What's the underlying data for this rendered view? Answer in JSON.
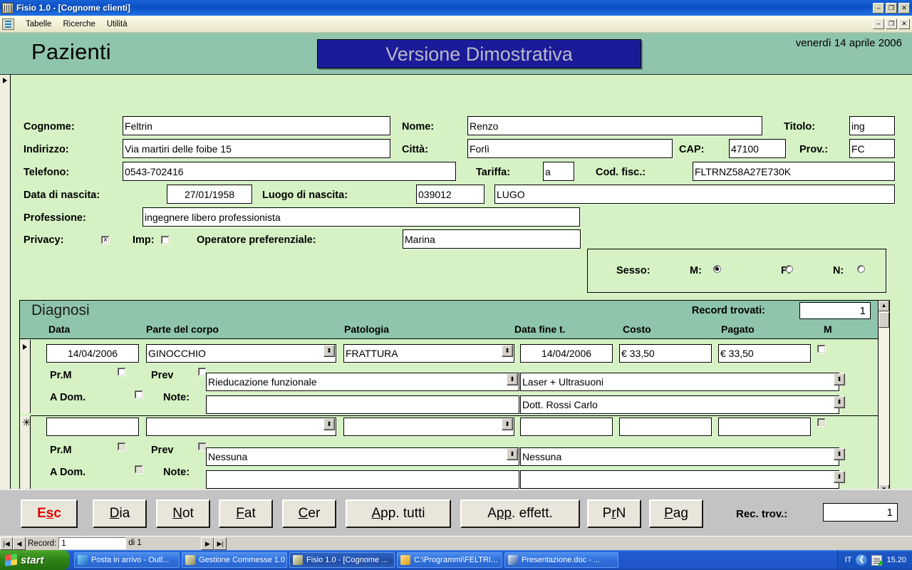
{
  "window": {
    "title": "Fisio 1.0 - [Cognome clienti]",
    "minimize": "–",
    "restore": "❐",
    "close": "✕"
  },
  "menu": {
    "items": [
      {
        "label": "Tabelle"
      },
      {
        "label": "Ricerche"
      },
      {
        "label": "Utilità"
      }
    ],
    "minimize": "–",
    "restore": "❐",
    "close": "✕"
  },
  "header": {
    "page_title": "Pazienti",
    "demo_badge": "Versione Dimostrativa",
    "today": "venerdì 14 aprile 2006"
  },
  "patient": {
    "cognome_label": "Cognome:",
    "cognome": "Feltrin",
    "nome_label": "Nome:",
    "nome": "Renzo",
    "titolo_label": "Titolo:",
    "titolo": "ing",
    "indirizzo_label": "Indirizzo:",
    "indirizzo": "Via martiri delle foibe 15",
    "citta_label": "Città:",
    "citta": "Forlì",
    "cap_label": "CAP:",
    "cap": "47100",
    "prov_label": "Prov.:",
    "prov": "FC",
    "telefono_label": "Telefono:",
    "telefono": "0543-702416",
    "tariffa_label": "Tariffa:",
    "tariffa": "a",
    "codfisc_label": "Cod. fisc.:",
    "codfisc": "FLTRNZ58A27E730K",
    "data_nascita_label": "Data di nascita:",
    "data_nascita": "27/01/1958",
    "luogo_nascita_label": "Luogo di nascita:",
    "luogo_nascita_code": "039012",
    "luogo_nascita": "LUGO",
    "professione_label": "Professione:",
    "professione": "ingegnere libero professionista",
    "privacy_label": "Privacy:",
    "privacy_checked": "x",
    "imp_label": "Imp:",
    "imp_checked": "",
    "operatore_label": "Operatore preferenziale:",
    "operatore": "Marina",
    "sesso_label": "Sesso:",
    "sesso_m_label": "M:",
    "sesso_f_label": "F:",
    "sesso_n_label": "N:",
    "sesso_value": "M"
  },
  "diagnosi": {
    "title": "Diagnosi",
    "record_trovati_label": "Record trovati:",
    "record_trovati": "1",
    "columns": [
      "Data",
      "Parte del corpo",
      "Patologia",
      "Data fine t.",
      "Costo",
      "Pagato",
      "M"
    ],
    "row_labels": {
      "prm": "Pr.M",
      "prev": "Prev",
      "adom": "A Dom.",
      "note": "Note:"
    },
    "rows": [
      {
        "selector": "▶",
        "data": "14/04/2006",
        "parte_del_corpo": "GINOCCHIO",
        "patologia": "FRATTURA",
        "data_fine": "14/04/2006",
        "costo": "€ 33,50",
        "pagato": "€ 33,50",
        "m_checked": "",
        "prm_checked": "",
        "prev_checked": "",
        "adom_checked": "",
        "terapia": "Rieducazione funzionale",
        "apparecchiatura": "Laser + Ultrasuoni",
        "note": "",
        "medico": "Dott. Rossi Carlo",
        "disabled": false
      },
      {
        "selector": "✳",
        "data": "",
        "parte_del_corpo": "",
        "patologia": "",
        "data_fine": "",
        "costo": "",
        "pagato": "",
        "m_checked": "",
        "prm_checked": "",
        "prev_checked": "",
        "adom_checked": "",
        "terapia": "Nessuna",
        "apparecchiatura": "Nessuna",
        "note": "",
        "medico": "",
        "disabled": true
      }
    ],
    "scroll_up": "▲",
    "scroll_down": "▼"
  },
  "footer": {
    "buttons": [
      {
        "name": "esc",
        "pre": "E",
        "u": "s",
        "post": "c",
        "style": "esc"
      },
      {
        "name": "dia",
        "pre": "",
        "u": "D",
        "post": "ia",
        "style": ""
      },
      {
        "name": "not",
        "pre": "",
        "u": "N",
        "post": "ot",
        "style": ""
      },
      {
        "name": "fat",
        "pre": "",
        "u": "F",
        "post": "at",
        "style": ""
      },
      {
        "name": "cer",
        "pre": "",
        "u": "C",
        "post": "er",
        "style": ""
      },
      {
        "name": "app-tutti",
        "pre": "",
        "u": "A",
        "post": "pp. tutti",
        "style": ""
      },
      {
        "name": "app-effett",
        "pre": "A",
        "u": "pp",
        "post": ". effett.",
        "style": ""
      },
      {
        "name": "prn",
        "pre": "P",
        "u": "r",
        "post": "N",
        "style": ""
      },
      {
        "name": "pag",
        "pre": "",
        "u": "P",
        "post": "ag",
        "style": ""
      }
    ],
    "rec_trov_label": "Rec. trov.:",
    "rec_trov_value": "1"
  },
  "navigator": {
    "first": "|◀",
    "prev": "◀",
    "next": "▶",
    "last": "▶|",
    "record_label": "Record:",
    "record_value": "1",
    "of_label": "di 1"
  },
  "taskbar": {
    "start": "start",
    "tasks": [
      {
        "label": "Posta in arrivo - Outl...",
        "icon": "mail-icon",
        "color": "#2c7fd0",
        "active": false
      },
      {
        "label": "Gestione Commesse 1.0",
        "icon": "app-icon",
        "color": "#c8b070",
        "active": false
      },
      {
        "label": "Fisio 1.0 - [Cognome ...",
        "icon": "app-icon",
        "color": "#c8b070",
        "active": true
      },
      {
        "label": "C:\\Programmi\\FELTRI...",
        "icon": "folder-icon",
        "color": "#f0c040",
        "active": false
      },
      {
        "label": "Presentazione.doc - ...",
        "icon": "word-icon",
        "color": "#2b579a",
        "active": false
      }
    ],
    "lang": "IT",
    "clock": "15.20"
  }
}
